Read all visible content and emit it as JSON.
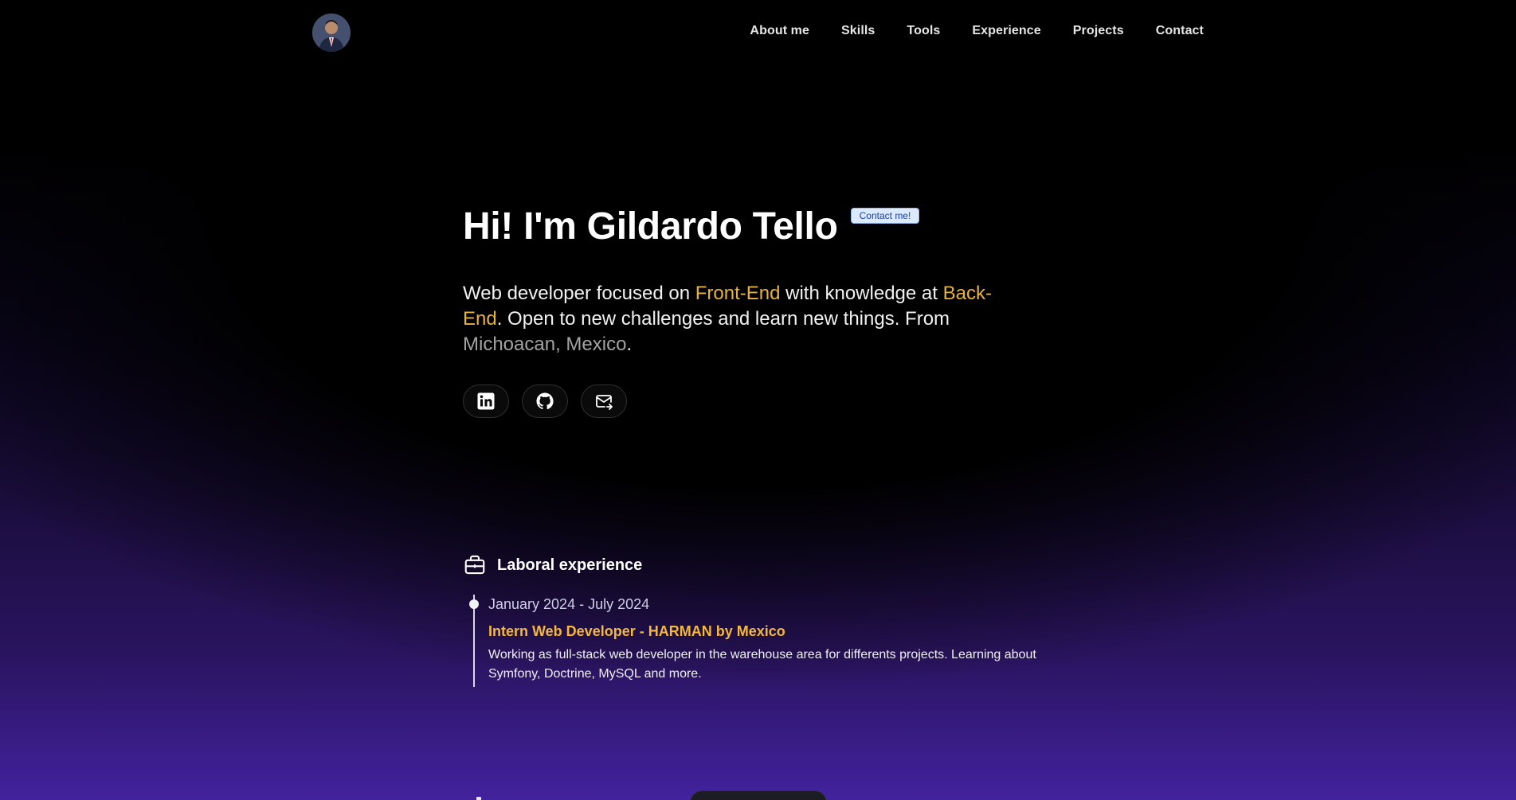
{
  "nav": {
    "items": [
      {
        "label": "About me"
      },
      {
        "label": "Skills"
      },
      {
        "label": "Tools"
      },
      {
        "label": "Experience"
      },
      {
        "label": "Projects"
      },
      {
        "label": "Contact"
      }
    ]
  },
  "hero": {
    "title": "Hi! I'm Gildardo Tello",
    "badge": "Contact me!",
    "intro_1": "Web developer focused on ",
    "intro_hl_1": "Front-End",
    "intro_2": " with knowledge at ",
    "intro_hl_2": "Back-End",
    "intro_3": ". Open to new challenges and learn new things. From ",
    "intro_location": "Michoacan, Mexico",
    "intro_4": ".",
    "socials": [
      {
        "icon": "linkedin-icon"
      },
      {
        "icon": "github-icon"
      },
      {
        "icon": "mail-icon"
      }
    ]
  },
  "experience": {
    "title": "Laboral experience",
    "icon": "briefcase-icon",
    "items": [
      {
        "date": "January 2024 - July 2024",
        "role": "Intern Web Developer - HARMAN by Mexico",
        "description": "Working as full-stack web developer in the warehouse area for differents projects. Learning about Symfony, Doctrine, MySQL and more."
      }
    ]
  },
  "colors": {
    "accent": "#e8b23b",
    "badge_bg": "#dbeafe",
    "badge_text": "#1e40af",
    "gradient_bottom": "#43229e"
  }
}
